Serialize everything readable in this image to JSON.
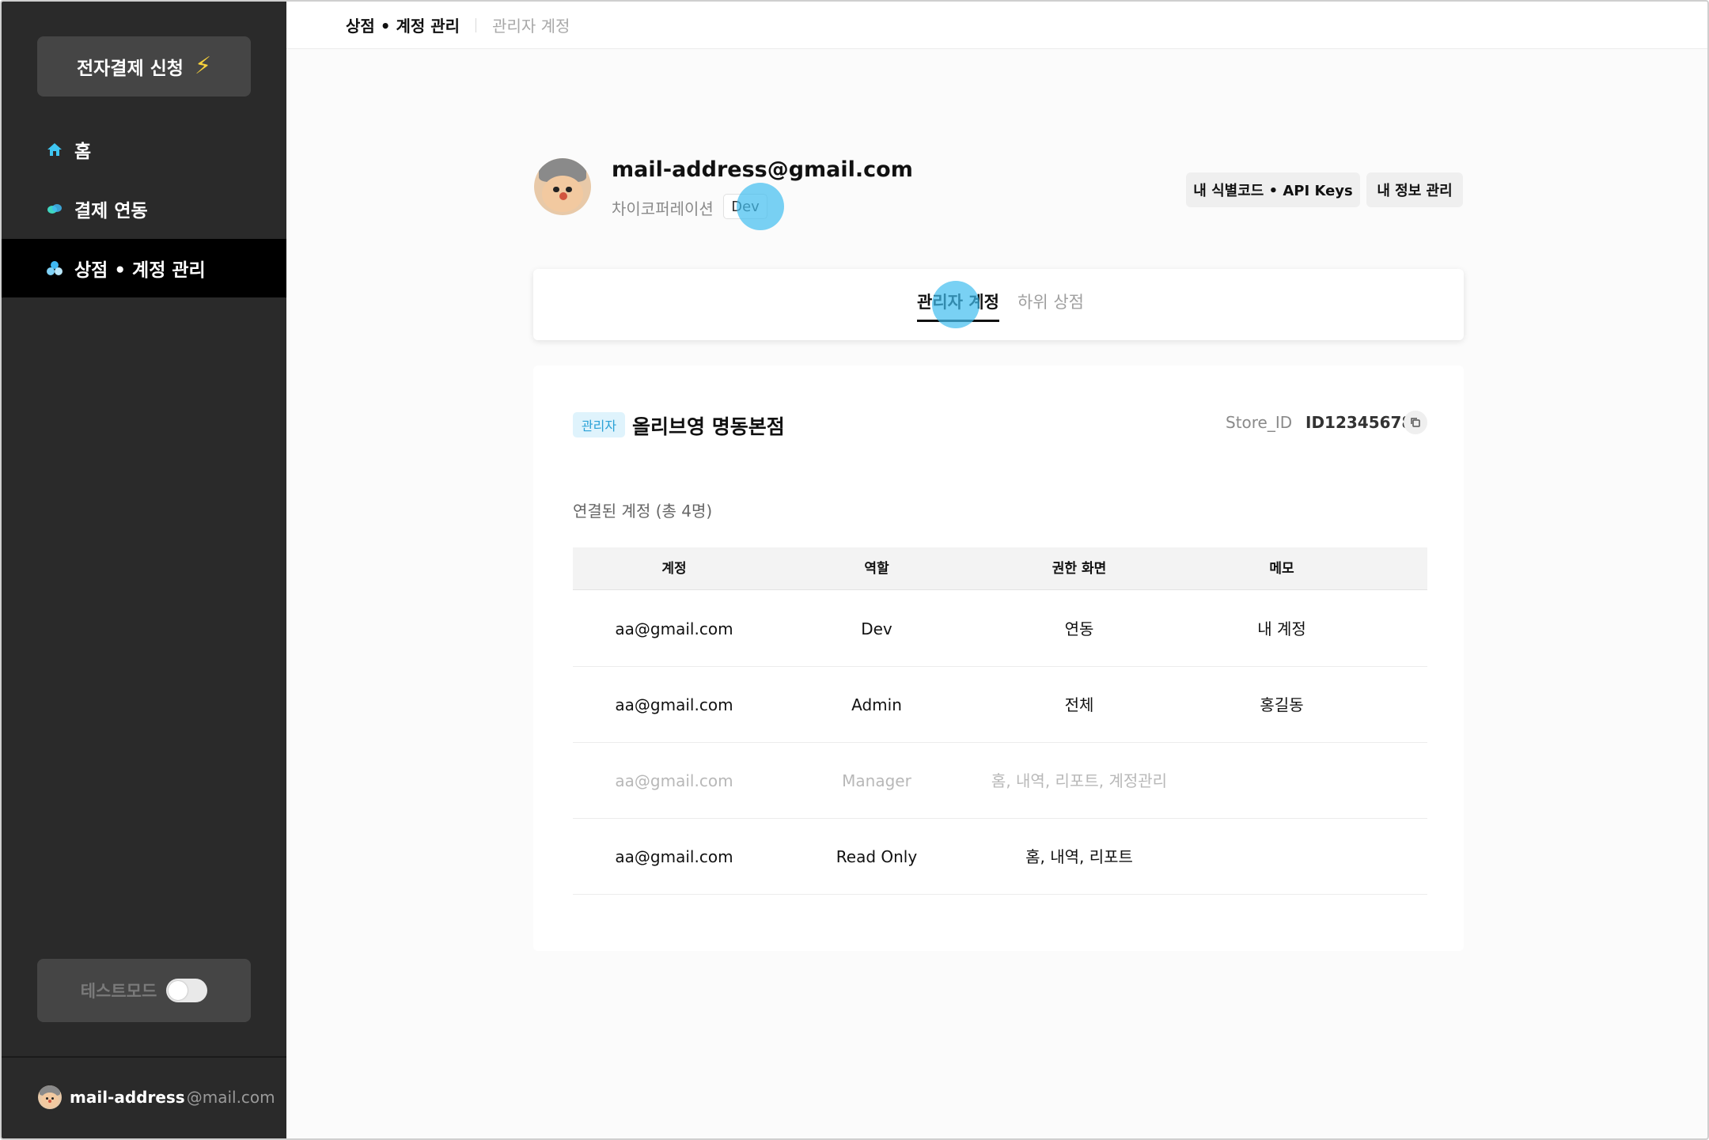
{
  "sidebar": {
    "apply_button": "전자결제 신청",
    "nav": [
      {
        "label": "홈",
        "icon": "home-icon"
      },
      {
        "label": "결제 연동",
        "icon": "link-icon"
      },
      {
        "label": "상점 • 계정 관리",
        "icon": "store-icon"
      }
    ],
    "test_mode_label": "테스트모드",
    "test_mode_on": false,
    "user_name": "mail-address",
    "user_domain": "@mail.com"
  },
  "breadcrumb": {
    "main": "상점 • 계정 관리",
    "sub": "관리자 계정"
  },
  "profile": {
    "email": "mail-address@gmail.com",
    "company": "차이코퍼레이션",
    "role_badge": "Dev"
  },
  "header_buttons": {
    "api_keys": "내 식별코드 • API Keys",
    "my_info": "내 정보 관리"
  },
  "tabs": [
    {
      "label": "관리자 계정",
      "active": true
    },
    {
      "label": "하위 상점",
      "active": false
    }
  ],
  "store": {
    "role_badge": "관리자",
    "name": "올리브영 명동본점",
    "id_label": "Store_ID",
    "id_value": "ID12345678"
  },
  "accounts": {
    "label": "연결된 계정 (총 4명)",
    "columns": [
      "계정",
      "역할",
      "권한 화면",
      "메모"
    ],
    "rows": [
      {
        "account": "aa@gmail.com",
        "role": "Dev",
        "screens": "연동",
        "memo": "내 계정",
        "disabled": false
      },
      {
        "account": "aa@gmail.com",
        "role": "Admin",
        "screens": "전체",
        "memo": "홍길동",
        "disabled": false
      },
      {
        "account": "aa@gmail.com",
        "role": "Manager",
        "screens": "홈, 내역, 리포트, 계정관리",
        "memo": "",
        "disabled": true
      },
      {
        "account": "aa@gmail.com",
        "role": "Read Only",
        "screens": "홈, 내역, 리포트",
        "memo": "",
        "disabled": false
      }
    ]
  },
  "colors": {
    "sidebar_bg": "#2a2a2a",
    "active_nav": "#000000",
    "accent_badge": "#2aa1d6",
    "click_indicator": "#40bef0",
    "bolt": "#f7d13b"
  }
}
